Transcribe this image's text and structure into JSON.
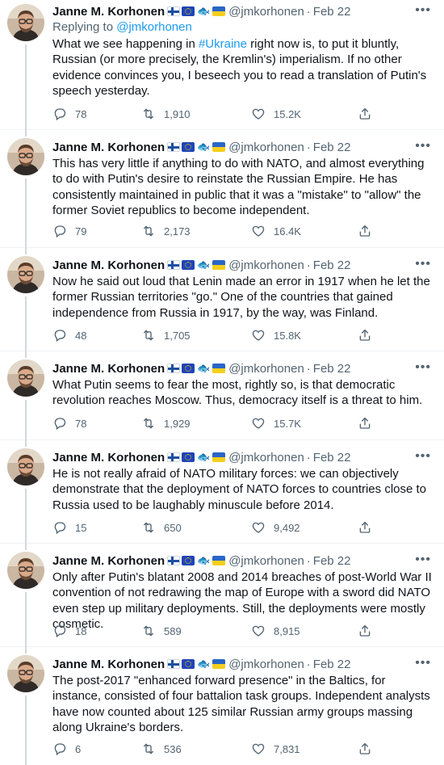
{
  "author": {
    "name": "Janne M. Korhonen",
    "handle": "@jmkorhonen",
    "date": "Feb 22",
    "separator": "·"
  },
  "icons": {
    "reply": "reply-icon",
    "retweet": "retweet-icon",
    "like": "heart-icon",
    "share": "share-icon",
    "more": "more-icon"
  },
  "first_reply": {
    "prefix": "Replying to ",
    "handle": "@jmkorhonen"
  },
  "tweets": [
    {
      "text_pre": "What we see happening in ",
      "hashtag": "#Ukraine",
      "text_post": " right now is, to put it bluntly, Russian (or more precisely, the Kremlin's) imperialism. If no other evidence convinces you, I beseech you to read a translation of Putin's speech yesterday.",
      "replies": "78",
      "retweets": "1,910",
      "likes": "15.2K"
    },
    {
      "text": "This has very little if anything to do with NATO, and almost everything to do with Putin's desire to reinstate the Russian Empire. He has consistently maintained in public that it was a \"mistake\" to \"allow\" the former Soviet republics to become independent.",
      "replies": "79",
      "retweets": "2,173",
      "likes": "16.4K"
    },
    {
      "text": "Now he said out loud that Lenin made an error in 1917 when he let the former Russian territories \"go.\" One of the countries that gained independence from Russia in 1917, by the way, was Finland.",
      "replies": "48",
      "retweets": "1,705",
      "likes": "15.8K"
    },
    {
      "text": "What Putin seems to fear the most, rightly so, is that democratic revolution reaches Moscow. Thus, democracy itself is a threat to him.",
      "replies": "78",
      "retweets": "1,929",
      "likes": "15.7K"
    },
    {
      "text": "He is not really afraid of NATO military forces: we can objectively demonstrate that the deployment of NATO forces to countries close to Russia used to be laughably minuscule before 2014.",
      "replies": "15",
      "retweets": "650",
      "likes": "9,492"
    },
    {
      "text": "Only after Putin's blatant 2008 and 2014 breaches of post-World War II convention of not redrawing the map of Europe with a sword did NATO even step up military deployments. Still, the deployments were mostly cosmetic.",
      "replies": "18",
      "retweets": "589",
      "likes": "8,915"
    },
    {
      "text": "The post-2017 \"enhanced forward presence\" in the Baltics, for instance, consisted of four battalion task groups. Independent analysts have now counted about 125 similar Russian army groups massing along Ukraine's borders.",
      "replies": "6",
      "retweets": "536",
      "likes": "7,831"
    }
  ]
}
